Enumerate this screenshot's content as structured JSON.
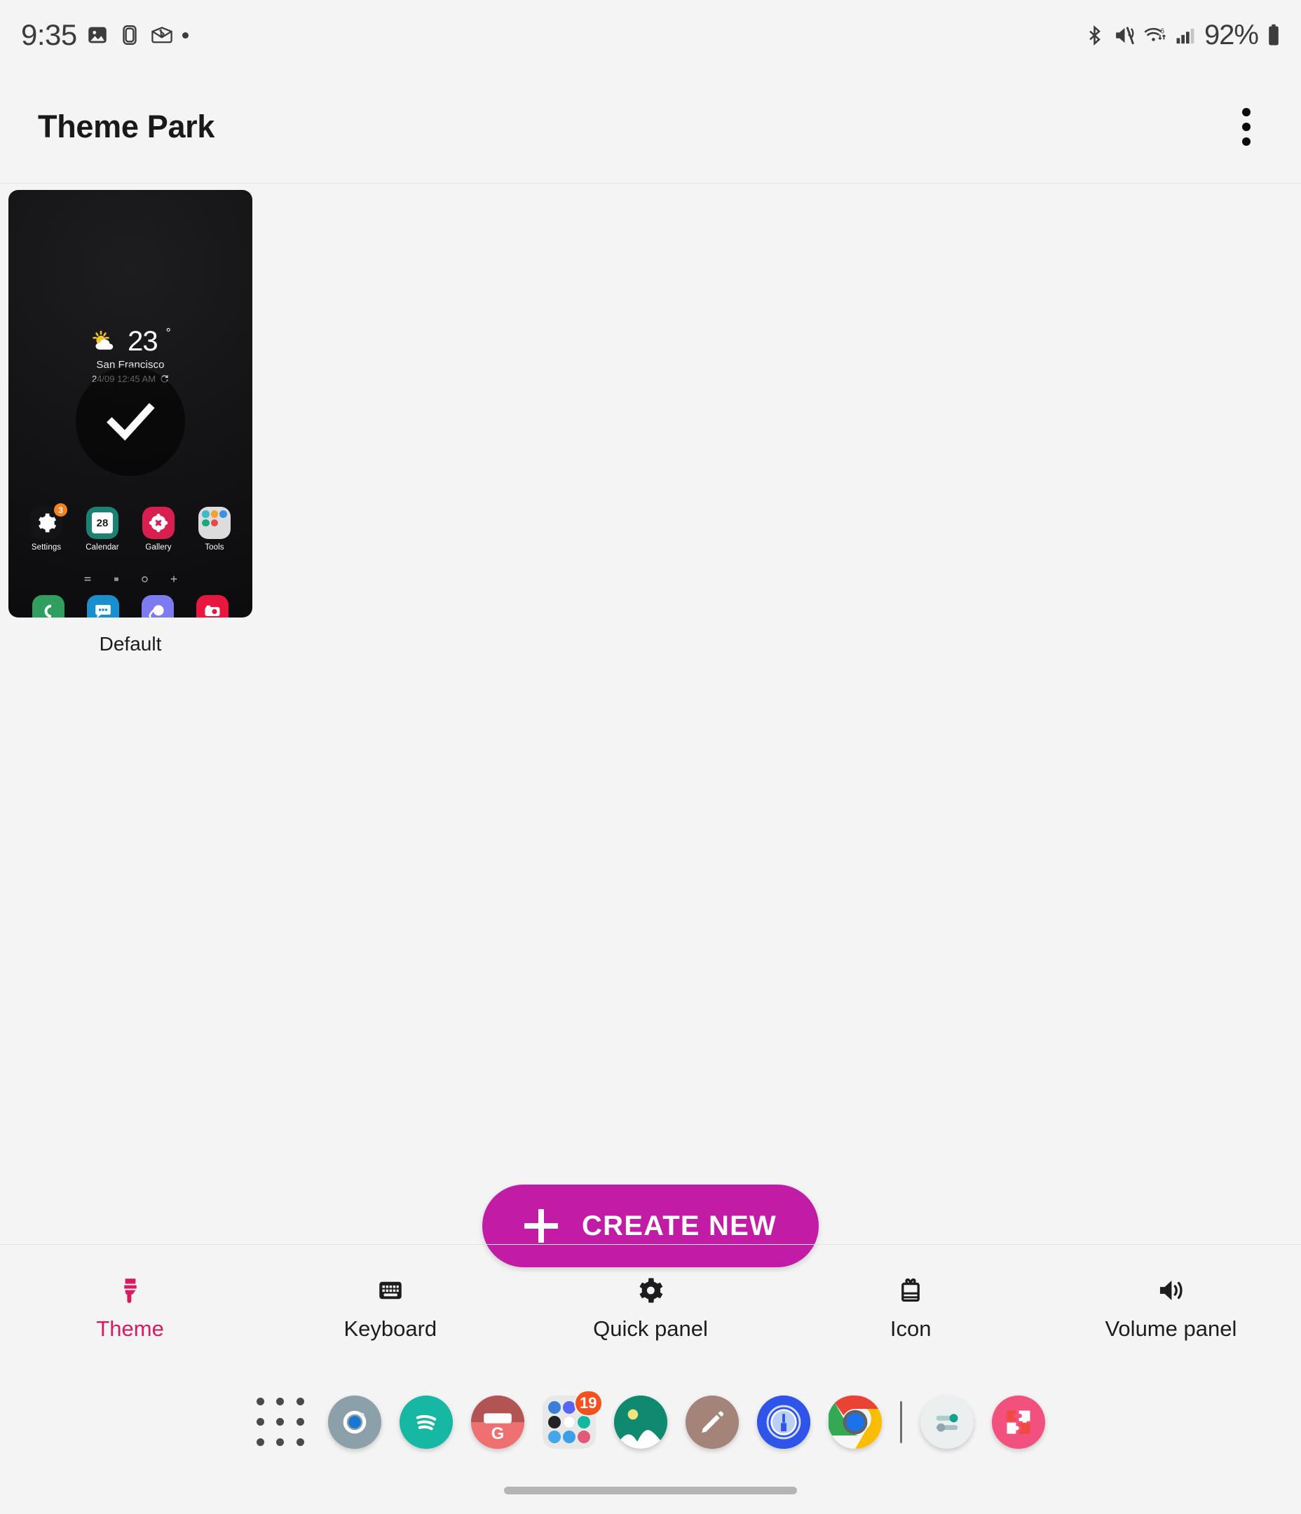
{
  "status_bar": {
    "time": "9:35",
    "battery_percent": "92%",
    "left_icons": [
      "image-icon",
      "sim-card-icon",
      "bluetooth-share-icon",
      "dot-indicator-icon"
    ],
    "right_icons": [
      "bluetooth-icon",
      "mute-icon",
      "wifi-6-icon",
      "signal-icon",
      "battery-icon"
    ]
  },
  "app_bar": {
    "title": "Theme Park",
    "more_icon": "more-vertical-icon"
  },
  "themes": [
    {
      "label": "Default",
      "selected": true,
      "preview": {
        "weather": {
          "temperature": "23",
          "degree": "°",
          "city": "San Francisco",
          "timestamp": "24/09 12:45 AM",
          "refresh_icon": "refresh-icon",
          "condition_icon": "partly-cloudy-icon"
        },
        "apps": [
          {
            "name": "Settings",
            "icon": "settings-gear-icon",
            "badge": "3",
            "color": "#1a1a1c"
          },
          {
            "name": "Calendar",
            "icon": "calendar-icon",
            "badge": "",
            "color": "#1a8274"
          },
          {
            "name": "Gallery",
            "icon": "gallery-flower-icon",
            "badge": "",
            "color": "#d91e50"
          },
          {
            "name": "Tools",
            "icon": "folder-icon",
            "badge": "",
            "color": "#dcdcdc"
          }
        ],
        "calendar_day": "28",
        "page_indicators": [
          "list-glyph",
          "home-glyph",
          "circle-glyph",
          "plus-glyph"
        ],
        "dock": [
          {
            "name": "Phone",
            "icon": "phone-icon",
            "color": "#2f9e5f"
          },
          {
            "name": "Messages",
            "icon": "message-icon",
            "color": "#1a8fcd"
          },
          {
            "name": "Internet",
            "icon": "internet-planet-icon",
            "color": "#7c7bf0"
          },
          {
            "name": "Camera",
            "icon": "camera-icon",
            "color": "#e8173f"
          }
        ]
      }
    }
  ],
  "create_button": {
    "label": "CREATE NEW",
    "icon": "plus-icon",
    "color": "#c21ba5"
  },
  "tabs": [
    {
      "label": "Theme",
      "icon": "paintbrush-icon",
      "active": true
    },
    {
      "label": "Keyboard",
      "icon": "keyboard-icon",
      "active": false
    },
    {
      "label": "Quick panel",
      "icon": "gear-icon",
      "active": false
    },
    {
      "label": "Icon",
      "icon": "gift-box-icon",
      "active": false
    },
    {
      "label": "Volume panel",
      "icon": "speaker-icon",
      "active": false
    }
  ],
  "accent_colors": {
    "active_tab": "#d81b60",
    "create_button": "#c21ba5",
    "badge_orange": "#f4511e"
  },
  "bottom_dock": [
    {
      "name": "App drawer",
      "icon": "app-grid-icon"
    },
    {
      "name": "Camera",
      "icon": "camera-circle-icon"
    },
    {
      "name": "Spotify",
      "icon": "spotify-icon"
    },
    {
      "name": "Gmail",
      "icon": "gmail-icon"
    },
    {
      "name": "Folder",
      "icon": "app-folder-icon",
      "badge": "19"
    },
    {
      "name": "Gallery",
      "icon": "photos-icon"
    },
    {
      "name": "Notes",
      "icon": "pencil-icon"
    },
    {
      "name": "1Password",
      "icon": "one-password-icon"
    },
    {
      "name": "Chrome",
      "icon": "chrome-icon"
    },
    {
      "name": "divider",
      "icon": "divider-icon"
    },
    {
      "name": "Settings",
      "icon": "toggles-icon"
    },
    {
      "name": "Puzzle app",
      "icon": "puzzle-icon"
    }
  ],
  "home_indicator": "home-indicator"
}
